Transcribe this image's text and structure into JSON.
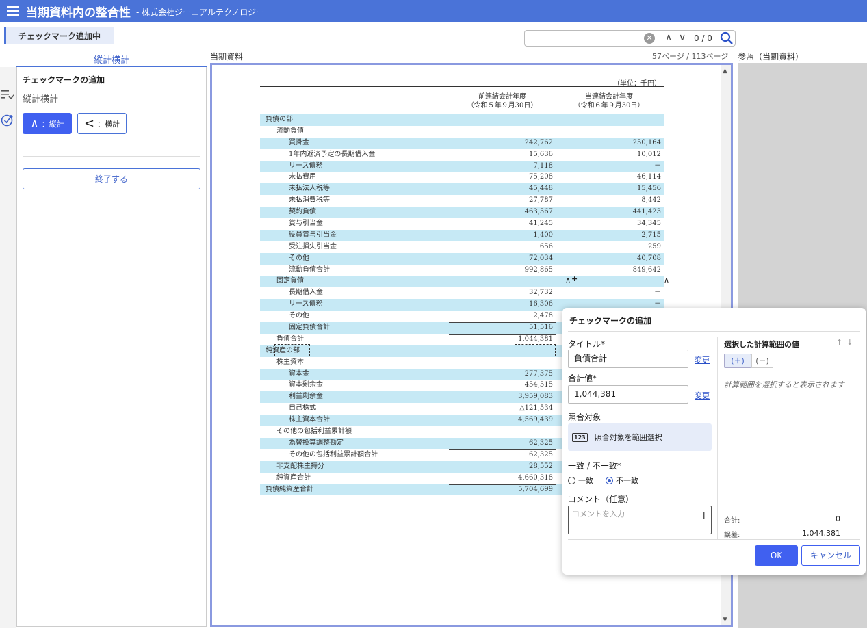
{
  "header": {
    "title": "当期資料内の整合性",
    "subtitle": "- 株式会社ジーニアルテクノロジー"
  },
  "mode_badge": "チェックマーク追加中",
  "search": {
    "value": "",
    "match_count": "0 / 0"
  },
  "left_panel": {
    "tab_label": "縦計横計",
    "heading": "チェックマークの追加",
    "subheading": "縦計横計",
    "vertical_button": {
      "symbol": "∧",
      "label": "：縦計"
    },
    "horizontal_button": {
      "symbol": "<",
      "label": "：横計"
    },
    "finish_button": "終了する"
  },
  "document": {
    "label": "当期資料",
    "page_info": "57ページ / 113ページ",
    "unit": "（単位：千円）",
    "col1_header": [
      "前連結会計年度",
      "（令和５年９月30日）"
    ],
    "col2_header": [
      "当連結会計年度",
      "（令和６年９月30日）"
    ],
    "rows": [
      {
        "label": "負債の部",
        "indent": 0,
        "v1": "",
        "v2": "",
        "hl": true,
        "sub": false
      },
      {
        "label": "流動負債",
        "indent": 1,
        "v1": "",
        "v2": "",
        "hl": false,
        "sub": false
      },
      {
        "label": "買掛金",
        "indent": 2,
        "v1": "242,762",
        "v2": "250,164",
        "hl": true,
        "sub": false
      },
      {
        "label": "1年内返済予定の長期借入金",
        "indent": 2,
        "v1": "15,636",
        "v2": "10,012",
        "hl": false,
        "sub": false
      },
      {
        "label": "リース債務",
        "indent": 2,
        "v1": "7,118",
        "v2": "－",
        "hl": true,
        "sub": false
      },
      {
        "label": "未払費用",
        "indent": 2,
        "v1": "75,208",
        "v2": "46,114",
        "hl": false,
        "sub": false
      },
      {
        "label": "未払法人税等",
        "indent": 2,
        "v1": "45,448",
        "v2": "15,456",
        "hl": true,
        "sub": false
      },
      {
        "label": "未払消費税等",
        "indent": 2,
        "v1": "27,787",
        "v2": "8,442",
        "hl": false,
        "sub": false
      },
      {
        "label": "契約負債",
        "indent": 2,
        "v1": "463,567",
        "v2": "441,423",
        "hl": true,
        "sub": false
      },
      {
        "label": "賞与引当金",
        "indent": 2,
        "v1": "41,245",
        "v2": "34,345",
        "hl": false,
        "sub": false
      },
      {
        "label": "役員賞与引当金",
        "indent": 2,
        "v1": "1,400",
        "v2": "2,715",
        "hl": true,
        "sub": false
      },
      {
        "label": "受注損失引当金",
        "indent": 2,
        "v1": "656",
        "v2": "259",
        "hl": false,
        "sub": false
      },
      {
        "label": "その他",
        "indent": 2,
        "v1": "72,034",
        "v2": "40,708",
        "hl": true,
        "sub": false
      },
      {
        "label": "流動負債合計",
        "indent": 2,
        "v1": "992,865",
        "v2": "849,642",
        "hl": false,
        "sub": true
      },
      {
        "label": "固定負債",
        "indent": 1,
        "v1": "",
        "v2": "",
        "hl": true,
        "sub": false
      },
      {
        "label": "長期借入金",
        "indent": 2,
        "v1": "32,732",
        "v2": "－",
        "hl": false,
        "sub": false
      },
      {
        "label": "リース債務",
        "indent": 2,
        "v1": "16,306",
        "v2": "－",
        "hl": true,
        "sub": false
      },
      {
        "label": "その他",
        "indent": 2,
        "v1": "2,478",
        "v2": "",
        "hl": false,
        "sub": false
      },
      {
        "label": "固定負債合計",
        "indent": 2,
        "v1": "51,516",
        "v2": "",
        "hl": true,
        "sub": true
      },
      {
        "label": "負債合計",
        "indent": 1,
        "v1": "1,044,381",
        "v2": "",
        "hl": false,
        "sub": true
      },
      {
        "label": "純資産の部",
        "indent": 0,
        "v1": "",
        "v2": "",
        "hl": true,
        "sub": false
      },
      {
        "label": "株主資本",
        "indent": 1,
        "v1": "",
        "v2": "",
        "hl": false,
        "sub": false
      },
      {
        "label": "資本金",
        "indent": 2,
        "v1": "277,375",
        "v2": "",
        "hl": true,
        "sub": false
      },
      {
        "label": "資本剰余金",
        "indent": 2,
        "v1": "454,515",
        "v2": "",
        "hl": false,
        "sub": false
      },
      {
        "label": "利益剰余金",
        "indent": 2,
        "v1": "3,959,083",
        "v2": "",
        "hl": true,
        "sub": false
      },
      {
        "label": "自己株式",
        "indent": 2,
        "v1": "△121,534",
        "v2": "",
        "hl": false,
        "sub": false
      },
      {
        "label": "株主資本合計",
        "indent": 2,
        "v1": "4,569,439",
        "v2": "",
        "hl": true,
        "sub": true
      },
      {
        "label": "その他の包括利益累計額",
        "indent": 1,
        "v1": "",
        "v2": "",
        "hl": false,
        "sub": false
      },
      {
        "label": "為替換算調整勘定",
        "indent": 2,
        "v1": "62,325",
        "v2": "",
        "hl": true,
        "sub": false
      },
      {
        "label": "その他の包括利益累計額合計",
        "indent": 2,
        "v1": "62,325",
        "v2": "",
        "hl": false,
        "sub": true
      },
      {
        "label": "非支配株主持分",
        "indent": 1,
        "v1": "28,552",
        "v2": "",
        "hl": true,
        "sub": false
      },
      {
        "label": "純資産合計",
        "indent": 1,
        "v1": "4,660,318",
        "v2": "",
        "hl": false,
        "sub": true
      },
      {
        "label": "負債純資産合計",
        "indent": 0,
        "v1": "5,704,699",
        "v2": "",
        "hl": true,
        "sub": true
      }
    ],
    "check_mark_symbol": "∧"
  },
  "reference": {
    "label": "参照（当期資料）"
  },
  "dialog": {
    "title": "チェックマークの追加",
    "title_field_label": "タイトル*",
    "title_value": "負債合計",
    "total_field_label": "合計値*",
    "total_value": "1,044,381",
    "change_link": "変更",
    "target_label": "照合対象",
    "range_icon": "123",
    "range_button": "照合対象を範囲選択",
    "match_label": "一致 / 不一致*",
    "match_option": "一致",
    "mismatch_option": "不一致",
    "selected": "mismatch",
    "comment_label": "コメント（任意）",
    "comment_placeholder": "コメントを入力",
    "right_title": "選択した計算範囲の値",
    "plus_toggle": "(＋)",
    "minus_toggle": "(－)",
    "hint": "計算範囲を選択すると表示されます",
    "total_label": "合計:",
    "total_result": "0",
    "diff_label": "誤差:",
    "diff_result": "1,044,381",
    "ok_button": "OK",
    "cancel_button": "キャンセル"
  }
}
